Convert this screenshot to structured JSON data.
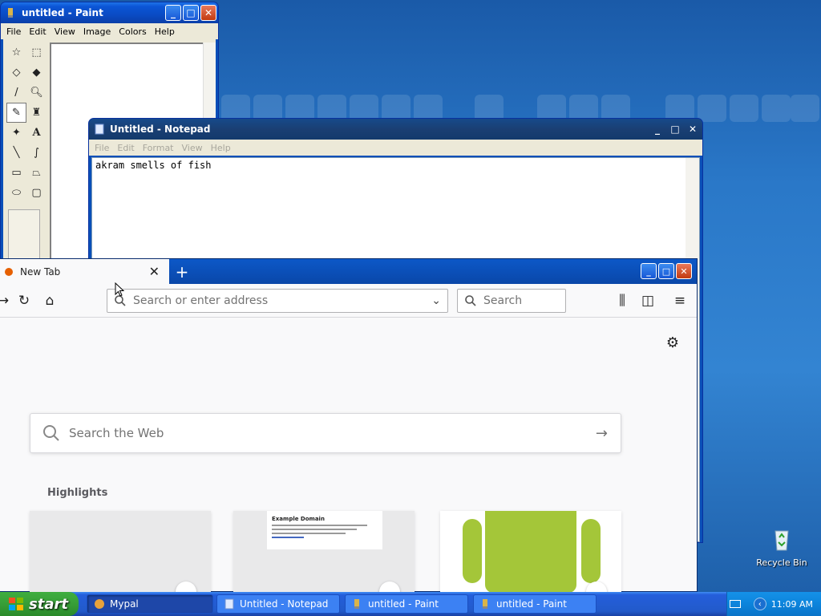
{
  "paint": {
    "title": "untitled - Paint",
    "menu": [
      "File",
      "Edit",
      "View",
      "Image",
      "Colors",
      "Help"
    ],
    "tools": [
      "free-select",
      "rect-select",
      "eraser",
      "fill",
      "color-picker",
      "magnifier",
      "pencil",
      "brush",
      "airbrush",
      "text",
      "line",
      "curve",
      "rectangle",
      "polygon",
      "ellipse",
      "rounded-rectangle"
    ]
  },
  "notepad": {
    "title": "Untitled - Notepad",
    "menu": [
      "File",
      "Edit",
      "Format",
      "View",
      "Help"
    ],
    "text": "akram smells of fish"
  },
  "firefox": {
    "tab_label": "New Tab",
    "url_placeholder": "Search or enter address",
    "search_placeholder": "Search",
    "web_search_placeholder": "Search the Web",
    "highlights_title": "Highlights",
    "example_domain_title": "Example Domain"
  },
  "desktop": {
    "recycle_bin_label": "Recycle Bin"
  },
  "taskbar": {
    "start_label": "start",
    "tasks": [
      "Mypal",
      "Untitled - Notepad",
      "untitled - Paint",
      "untitled - Paint"
    ],
    "clock": "11:09 AM"
  },
  "colors": {
    "xp_blue": "#0a4bc4",
    "start_green": "#379e37",
    "android_green": "#a4c639"
  }
}
